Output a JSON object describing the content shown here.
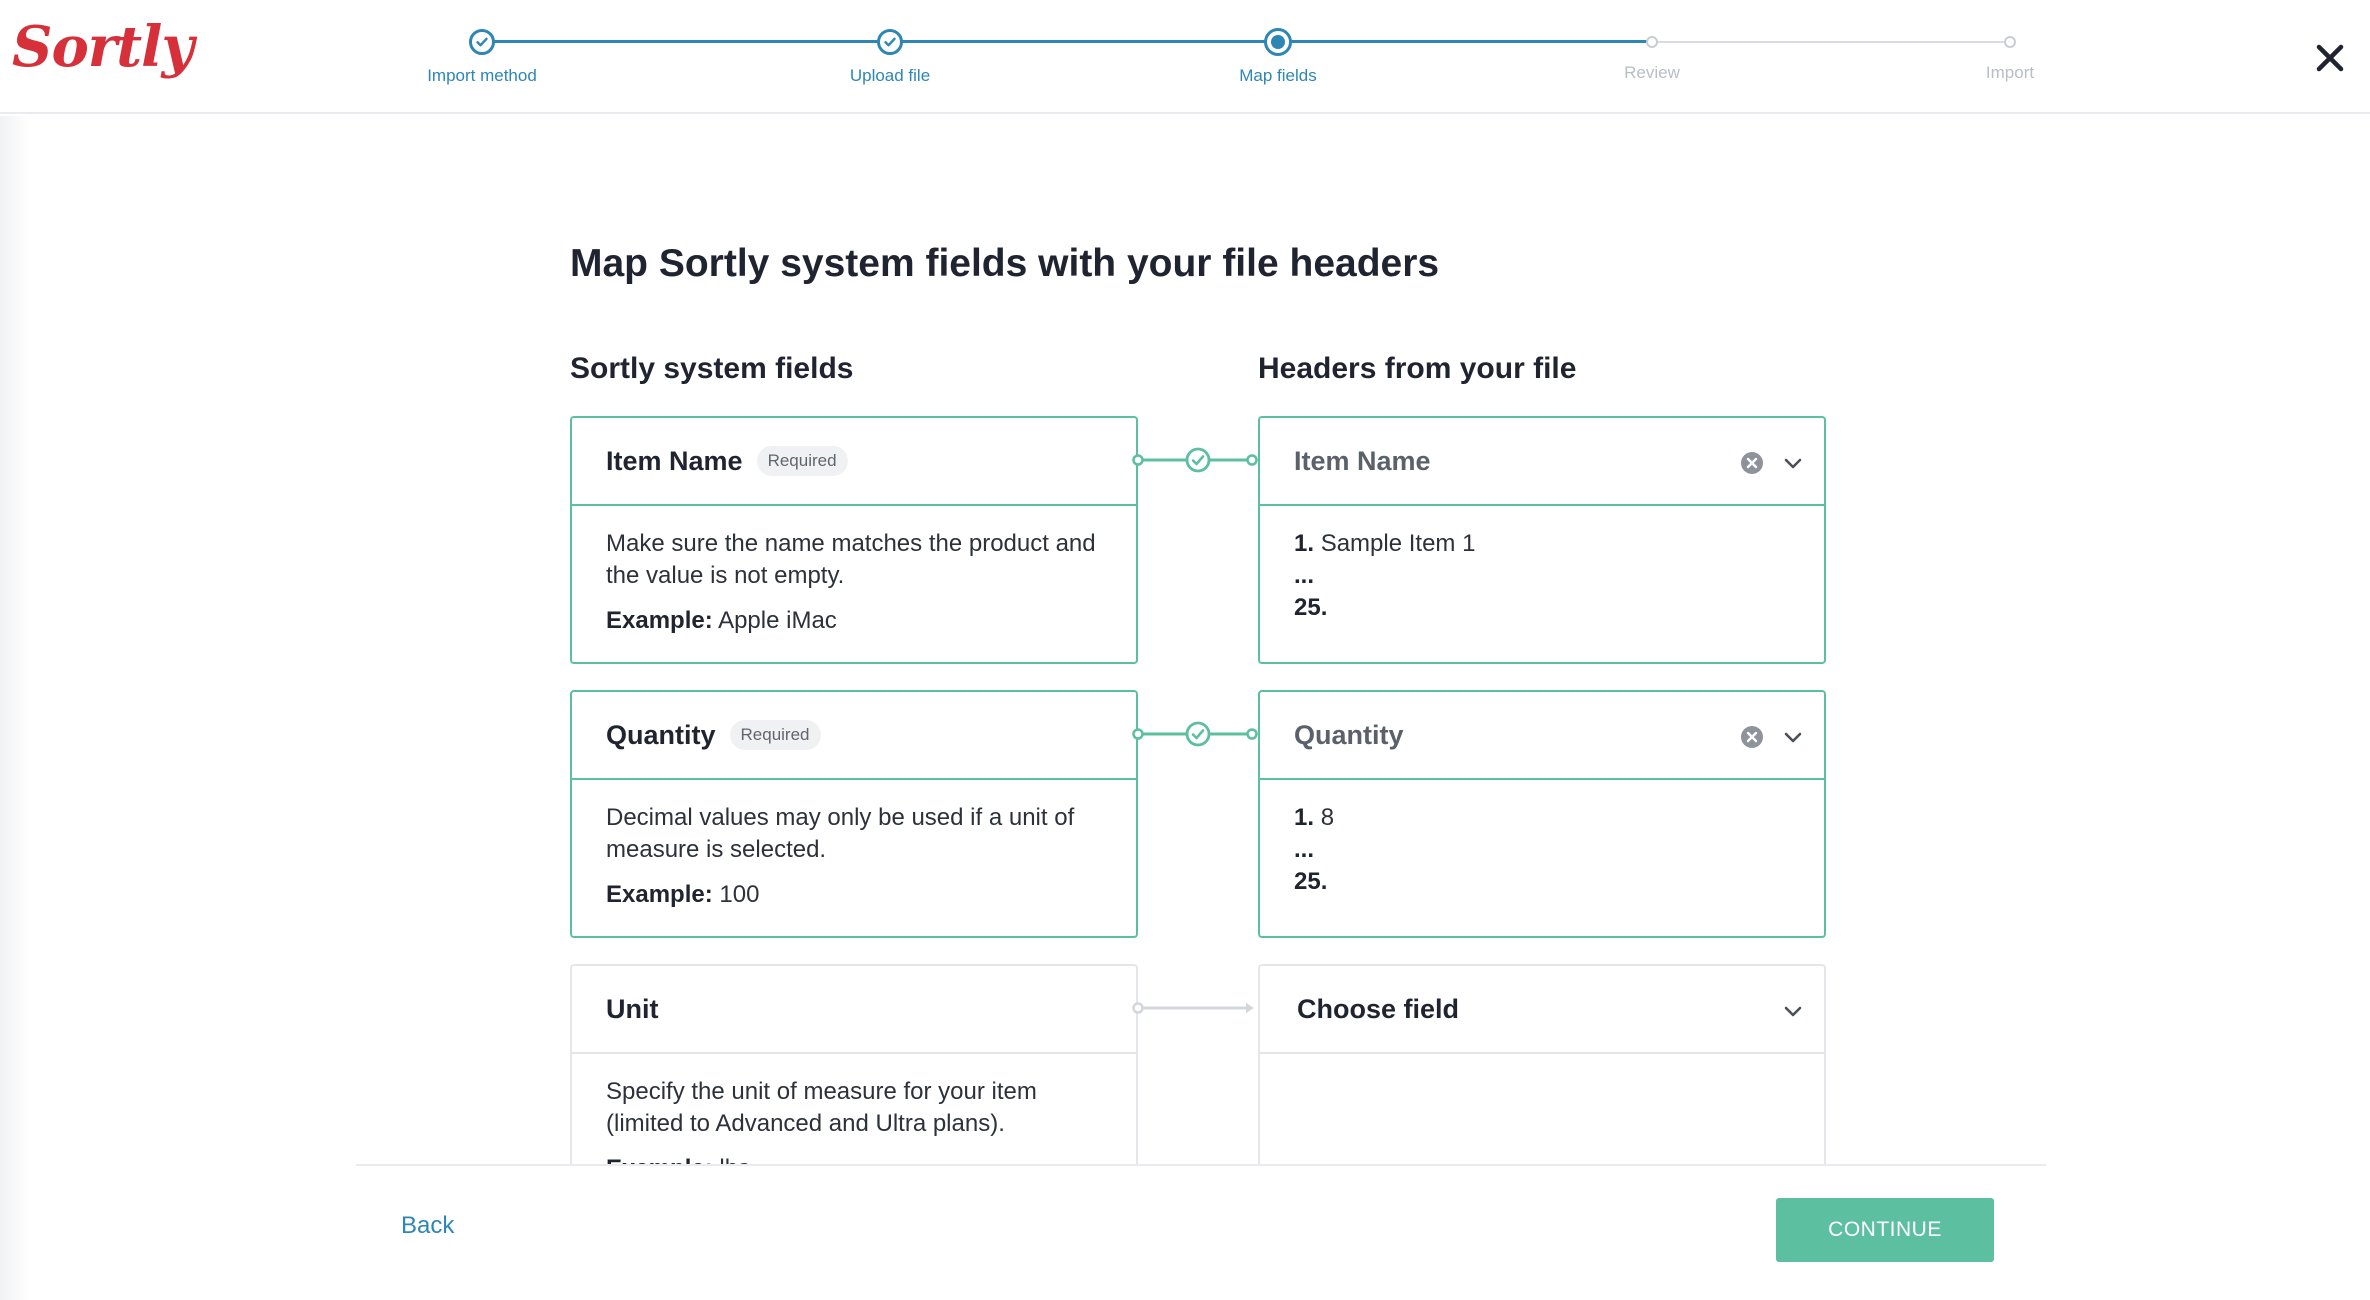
{
  "app": {
    "logo_text": "Sortly",
    "brand_color": "#d6303b",
    "accent_color": "#2e86b5",
    "success_color": "#5cbf9f"
  },
  "stepper": {
    "steps": [
      {
        "label": "Import method",
        "state": "done"
      },
      {
        "label": "Upload file",
        "state": "done"
      },
      {
        "label": "Map fields",
        "state": "current"
      },
      {
        "label": "Review",
        "state": "todo"
      },
      {
        "label": "Import",
        "state": "todo"
      }
    ]
  },
  "header": {
    "close_icon": "close-icon"
  },
  "main": {
    "title": "Map Sortly system fields with your file headers",
    "left_heading": "Sortly system fields",
    "right_heading": "Headers from your file",
    "mappings": [
      {
        "field_name": "Item Name",
        "badge": "Required",
        "description": "Make sure the name matches the product and the value is not empty.",
        "example_label": "Example:",
        "example_value": "Apple iMac",
        "mapped_header": "Item Name",
        "sample_first_num": "1.",
        "sample_first_value": "Sample Item 1",
        "sample_ellipsis": "...",
        "sample_last_num": "25.",
        "status": "mapped"
      },
      {
        "field_name": "Quantity",
        "badge": "Required",
        "description": "Decimal values may only be used if a unit of measure is selected.",
        "example_label": "Example:",
        "example_value": "100",
        "mapped_header": "Quantity",
        "sample_first_num": "1.",
        "sample_first_value": "8",
        "sample_ellipsis": "...",
        "sample_last_num": "25.",
        "status": "mapped"
      },
      {
        "field_name": "Unit",
        "badge": "",
        "description": "Specify the unit of measure for your item (limited to Advanced and Ultra plans).",
        "example_label": "Example:",
        "example_value": "lbs",
        "mapped_header": "Choose field",
        "status": "unmapped"
      }
    ]
  },
  "footer": {
    "back_label": "Back",
    "continue_label": "CONTINUE"
  }
}
